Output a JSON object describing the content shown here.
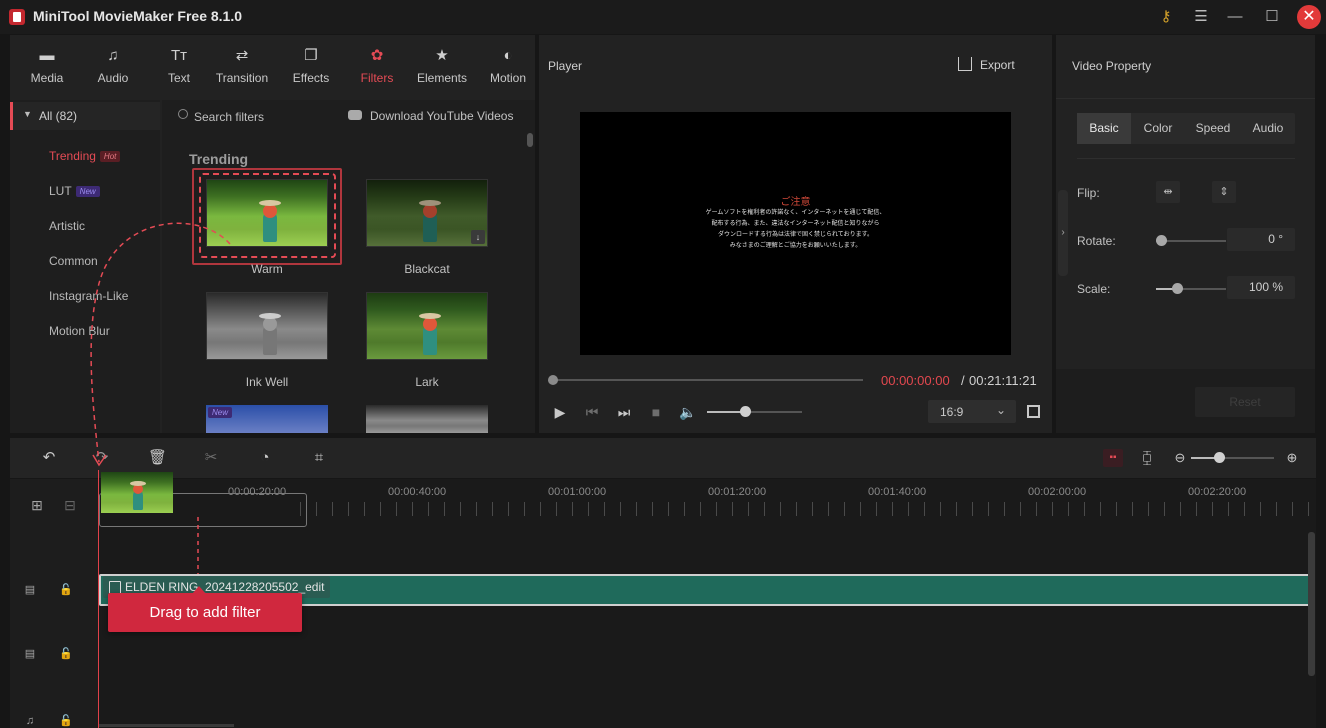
{
  "app": {
    "title": "MiniTool MovieMaker Free 8.1.0"
  },
  "toolbar": [
    {
      "label": "Media",
      "icon": "folder-icon",
      "glyph": "▬"
    },
    {
      "label": "Audio",
      "icon": "music-note-icon",
      "glyph": "♫"
    },
    {
      "label": "Text",
      "icon": "text-icon",
      "glyph": "Tт"
    },
    {
      "label": "Transition",
      "icon": "swap-arrows-icon",
      "glyph": "⇄"
    },
    {
      "label": "Effects",
      "icon": "layers-icon",
      "glyph": "❐"
    },
    {
      "label": "Filters",
      "icon": "filters-icon",
      "glyph": "✿"
    },
    {
      "label": "Elements",
      "icon": "star-icon",
      "glyph": "★"
    },
    {
      "label": "Motion",
      "icon": "motion-icon",
      "glyph": "◐"
    }
  ],
  "categories": {
    "all_label": "All (82)",
    "items": [
      {
        "label": "Trending",
        "badge": "Hot"
      },
      {
        "label": "LUT",
        "badge": "New"
      },
      {
        "label": "Artistic"
      },
      {
        "label": "Common"
      },
      {
        "label": "Instagram-Like"
      },
      {
        "label": "Motion Blur"
      }
    ]
  },
  "filters_panel": {
    "search_placeholder": "Search filters",
    "youtube_link": "Download YouTube Videos",
    "section_title": "Trending",
    "thumbnails": [
      {
        "label": "Warm"
      },
      {
        "label": "Blackcat"
      },
      {
        "label": "Ink Well"
      },
      {
        "label": "Lark"
      }
    ],
    "next_row_badge": "New"
  },
  "player": {
    "title": "Player",
    "export_label": "Export",
    "notice_title": "ご注意",
    "notice_lines": [
      "ゲームソフトを権利者の許諾なく、インターネットを通じて配信、",
      "配布する行為、また、違法なインターネット配信と知りながら",
      "ダウンロードする行為は法律で固く禁じられております。",
      "みなさまのご理解とご協力をお願いいたします。"
    ],
    "time_current": "00:00:00:00",
    "time_separator": "/",
    "time_total": "00:21:11:21",
    "aspect_ratio": "16:9",
    "volume_level": 0.4,
    "progress": 0
  },
  "properties": {
    "title": "Video Property",
    "tabs": [
      "Basic",
      "Color",
      "Speed",
      "Audio"
    ],
    "active_tab": "Basic",
    "flip_label": "Flip:",
    "rotate_label": "Rotate:",
    "rotate_value": "0 °",
    "scale_label": "Scale:",
    "scale_value": "100 %",
    "reset_label": "Reset"
  },
  "timeline": {
    "ruler_labels": [
      "00:00:20:00",
      "00:00:40:00",
      "00:01:00:00",
      "00:01:20:00",
      "00:01:40:00",
      "00:02:00:00",
      "00:02:20:00"
    ],
    "clip_name": "ELDEN RING_20241228205502_edit",
    "tooltip": "Drag to add filter",
    "zoom_level": 0.35
  },
  "colors": {
    "accent": "#e44b55",
    "clip": "#1f6a5b",
    "tooltip": "#d0283e"
  }
}
